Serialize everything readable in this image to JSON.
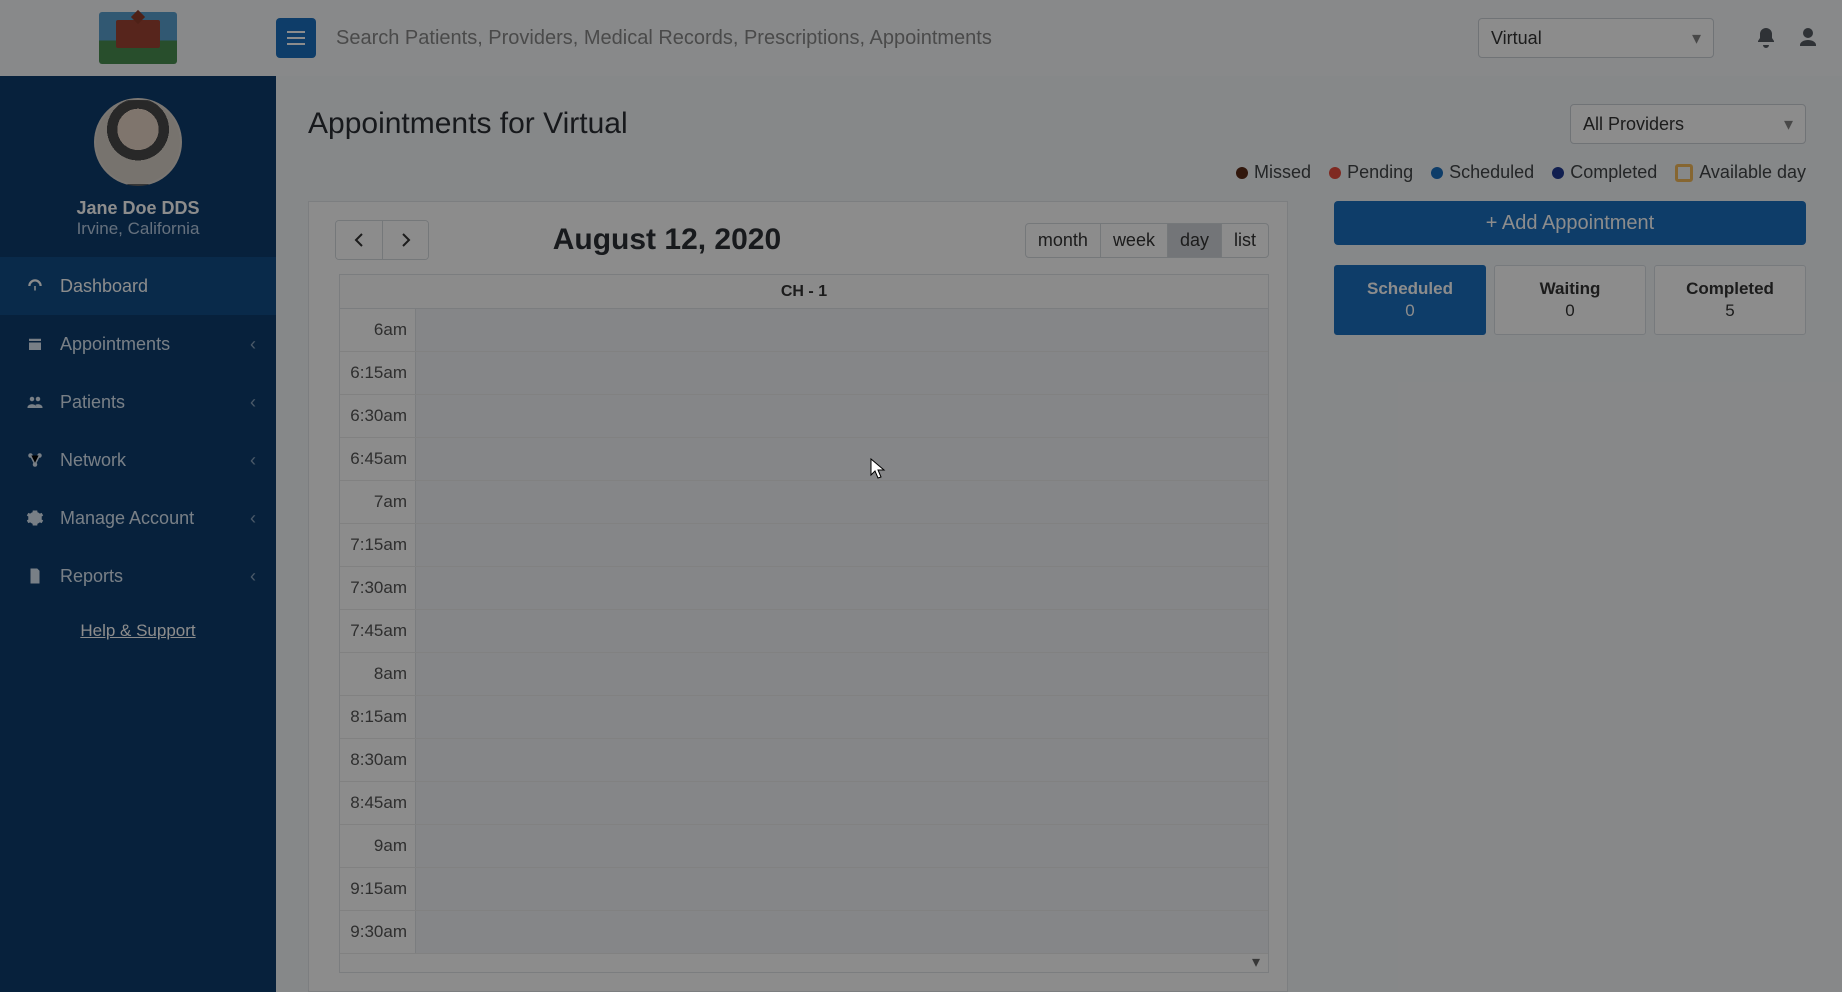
{
  "header": {
    "search_placeholder": "Search Patients, Providers, Medical Records, Prescriptions, Appointments",
    "location_selected": "Virtual"
  },
  "user": {
    "name": "Jane Doe DDS",
    "location": "Irvine, California"
  },
  "nav": {
    "dashboard": "Dashboard",
    "appointments": "Appointments",
    "patients": "Patients",
    "network": "Network",
    "manage": "Manage Account",
    "reports": "Reports",
    "help": "Help & Support"
  },
  "page": {
    "title": "Appointments for Virtual",
    "provider_selected": "All Providers"
  },
  "legend": {
    "missed": {
      "label": "Missed",
      "color": "#5a2a16"
    },
    "pending": {
      "label": "Pending",
      "color": "#e74c3c"
    },
    "scheduled": {
      "label": "Scheduled",
      "color": "#1a6fbf"
    },
    "completed": {
      "label": "Completed",
      "color": "#1f3a93"
    },
    "available": {
      "label": "Available day"
    }
  },
  "calendar": {
    "date": "August 12, 2020",
    "views": {
      "month": "month",
      "week": "week",
      "day": "day",
      "list": "list"
    },
    "active_view": "day",
    "column_header": "CH - 1",
    "slots": [
      "6am",
      "6:15am",
      "6:30am",
      "6:45am",
      "7am",
      "7:15am",
      "7:30am",
      "7:45am",
      "8am",
      "8:15am",
      "8:30am",
      "8:45am",
      "9am",
      "9:15am",
      "9:30am"
    ]
  },
  "right": {
    "add_label": "+ Add Appointment",
    "stats": {
      "scheduled": {
        "label": "Scheduled",
        "value": "0"
      },
      "waiting": {
        "label": "Waiting",
        "value": "0"
      },
      "completed": {
        "label": "Completed",
        "value": "5"
      }
    }
  }
}
